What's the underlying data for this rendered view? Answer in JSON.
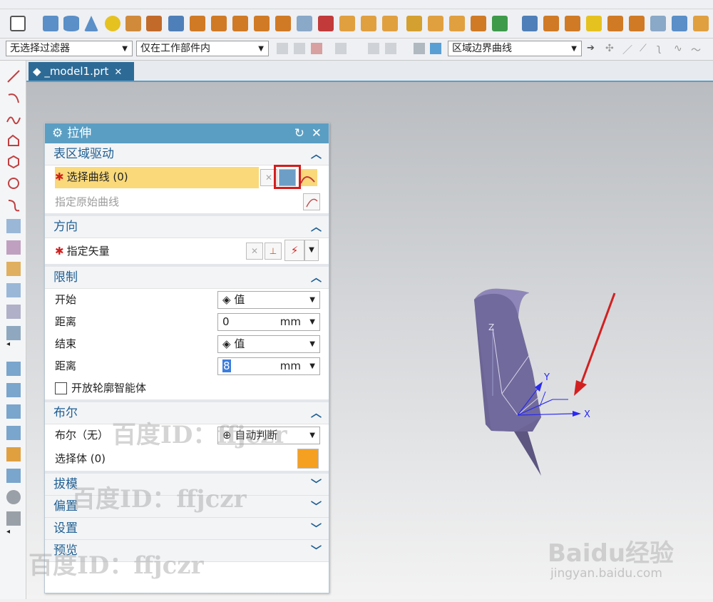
{
  "toolbar": {
    "row2": {
      "filter_label": "无选择过滤器",
      "scope_label": "仅在工作部件内",
      "curve_rule_label": "区域边界曲线"
    }
  },
  "tab": {
    "label": "_model1.prt"
  },
  "dialog": {
    "title": "拉伸",
    "sections": {
      "surface_region": {
        "title": "表区域驱动",
        "select_curve": "选择曲线 (0)",
        "specify_original": "指定原始曲线"
      },
      "direction": {
        "title": "方向",
        "specify_vector": "指定矢量"
      },
      "limits": {
        "title": "限制",
        "start_label": "开始",
        "start_value": "值",
        "distance1_label": "距离",
        "distance1_value": "0",
        "distance1_unit": "mm",
        "end_label": "结束",
        "end_value": "值",
        "distance2_label": "距离",
        "distance2_value": "8",
        "distance2_unit": "mm",
        "open_profile_label": "开放轮廓智能体"
      },
      "boolean": {
        "title": "布尔",
        "bool_label": "布尔（无）",
        "bool_value": "自动判断",
        "select_body": "选择体 (0)"
      },
      "draft": {
        "title": "拔模"
      },
      "offset": {
        "title": "偏置"
      },
      "settings": {
        "title": "设置"
      },
      "preview": {
        "title": "预览"
      }
    }
  },
  "viewport": {
    "axis_x": "X",
    "axis_y": "Y",
    "axis_z": "Z"
  },
  "watermarks": {
    "text": "百度ID：ffjczr",
    "baidu_logo": "Baidu经验",
    "baidu_url": "jingyan.baidu.com"
  }
}
